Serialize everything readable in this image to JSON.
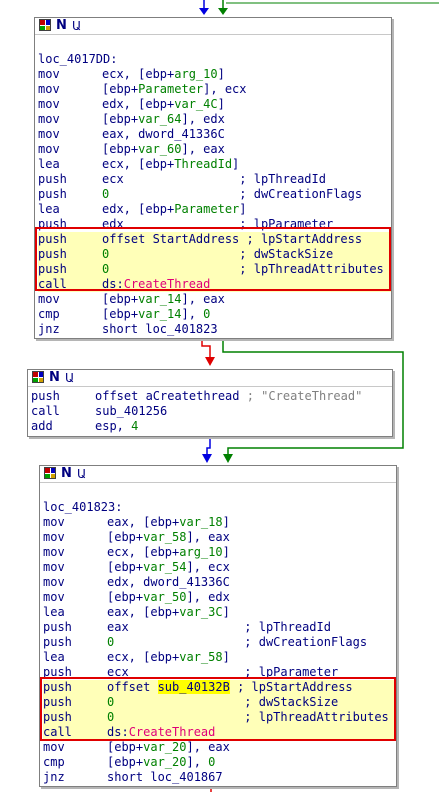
{
  "node1": {
    "label": "loc_4017DD:",
    "lines": [
      {
        "mn": "mov",
        "op": [
          {
            "t": "ecx, [ebp+",
            "c": "op"
          },
          {
            "t": "arg_10",
            "c": "var"
          },
          {
            "t": "]",
            "c": "op"
          }
        ]
      },
      {
        "mn": "mov",
        "op": [
          {
            "t": "[ebp+",
            "c": "op"
          },
          {
            "t": "Parameter",
            "c": "var"
          },
          {
            "t": "], ecx",
            "c": "op"
          }
        ]
      },
      {
        "mn": "mov",
        "op": [
          {
            "t": "edx, [ebp+",
            "c": "op"
          },
          {
            "t": "var_4C",
            "c": "var"
          },
          {
            "t": "]",
            "c": "op"
          }
        ]
      },
      {
        "mn": "mov",
        "op": [
          {
            "t": "[ebp+",
            "c": "op"
          },
          {
            "t": "var_64",
            "c": "var"
          },
          {
            "t": "], edx",
            "c": "op"
          }
        ]
      },
      {
        "mn": "mov",
        "op": [
          {
            "t": "eax, dword_41336C",
            "c": "op"
          }
        ]
      },
      {
        "mn": "mov",
        "op": [
          {
            "t": "[ebp+",
            "c": "op"
          },
          {
            "t": "var_60",
            "c": "var"
          },
          {
            "t": "], eax",
            "c": "op"
          }
        ]
      },
      {
        "mn": "lea",
        "op": [
          {
            "t": "ecx, [ebp+",
            "c": "op"
          },
          {
            "t": "ThreadId",
            "c": "var"
          },
          {
            "t": "]",
            "c": "op"
          }
        ]
      },
      {
        "mn": "push",
        "op": [
          {
            "t": "ecx                ",
            "c": "op"
          },
          {
            "t": "; lpThreadId",
            "c": "op"
          }
        ]
      },
      {
        "mn": "push",
        "op": [
          {
            "t": "0",
            "c": "num"
          },
          {
            "t": "                  ",
            "c": "op"
          },
          {
            "t": "; dwCreationFlags",
            "c": "op"
          }
        ]
      },
      {
        "mn": "lea",
        "op": [
          {
            "t": "edx, [ebp+",
            "c": "op"
          },
          {
            "t": "Parameter",
            "c": "var"
          },
          {
            "t": "]",
            "c": "op"
          }
        ]
      },
      {
        "mn": "push",
        "op": [
          {
            "t": "edx                ",
            "c": "op"
          },
          {
            "t": "; lpParameter",
            "c": "op"
          }
        ]
      },
      {
        "mn": "push",
        "op": [
          {
            "t": "offset StartAddress ",
            "c": "op"
          },
          {
            "t": "; lpStartAddress",
            "c": "op"
          }
        ],
        "y": true
      },
      {
        "mn": "push",
        "op": [
          {
            "t": "0",
            "c": "num"
          },
          {
            "t": "                  ",
            "c": "op"
          },
          {
            "t": "; dwStackSize",
            "c": "op"
          }
        ],
        "y": true
      },
      {
        "mn": "push",
        "op": [
          {
            "t": "0",
            "c": "num"
          },
          {
            "t": "                  ",
            "c": "op"
          },
          {
            "t": "; lpThreadAttributes",
            "c": "op"
          }
        ],
        "y": true
      },
      {
        "mn": "call",
        "op": [
          {
            "t": "ds:",
            "c": "op"
          },
          {
            "t": "CreateThread",
            "c": "imp"
          }
        ],
        "y": true
      },
      {
        "mn": "mov",
        "op": [
          {
            "t": "[ebp+",
            "c": "op"
          },
          {
            "t": "var_14",
            "c": "var"
          },
          {
            "t": "], eax",
            "c": "op"
          }
        ]
      },
      {
        "mn": "cmp",
        "op": [
          {
            "t": "[ebp+",
            "c": "op"
          },
          {
            "t": "var_14",
            "c": "var"
          },
          {
            "t": "], ",
            "c": "op"
          },
          {
            "t": "0",
            "c": "num"
          }
        ]
      },
      {
        "mn": "jnz",
        "op": [
          {
            "t": "short loc_401823",
            "c": "op"
          }
        ]
      }
    ]
  },
  "node2": {
    "lines": [
      {
        "mn": "push",
        "op": [
          {
            "t": "offset aCreatethread ",
            "c": "op"
          },
          {
            "t": "; \"CreateThread\"",
            "c": "com"
          }
        ]
      },
      {
        "mn": "call",
        "op": [
          {
            "t": "sub_401256",
            "c": "op"
          }
        ]
      },
      {
        "mn": "add",
        "op": [
          {
            "t": "esp, ",
            "c": "op"
          },
          {
            "t": "4",
            "c": "num"
          }
        ]
      }
    ]
  },
  "node3": {
    "label": "loc_401823:",
    "lines": [
      {
        "mn": "mov",
        "op": [
          {
            "t": "eax, [ebp+",
            "c": "op"
          },
          {
            "t": "var_18",
            "c": "var"
          },
          {
            "t": "]",
            "c": "op"
          }
        ]
      },
      {
        "mn": "mov",
        "op": [
          {
            "t": "[ebp+",
            "c": "op"
          },
          {
            "t": "var_58",
            "c": "var"
          },
          {
            "t": "], eax",
            "c": "op"
          }
        ]
      },
      {
        "mn": "mov",
        "op": [
          {
            "t": "ecx, [ebp+",
            "c": "op"
          },
          {
            "t": "arg_10",
            "c": "var"
          },
          {
            "t": "]",
            "c": "op"
          }
        ]
      },
      {
        "mn": "mov",
        "op": [
          {
            "t": "[ebp+",
            "c": "op"
          },
          {
            "t": "var_54",
            "c": "var"
          },
          {
            "t": "], ecx",
            "c": "op"
          }
        ]
      },
      {
        "mn": "mov",
        "op": [
          {
            "t": "edx, dword_41336C",
            "c": "op"
          }
        ]
      },
      {
        "mn": "mov",
        "op": [
          {
            "t": "[ebp+",
            "c": "op"
          },
          {
            "t": "var_50",
            "c": "var"
          },
          {
            "t": "], edx",
            "c": "op"
          }
        ]
      },
      {
        "mn": "lea",
        "op": [
          {
            "t": "eax, [ebp+",
            "c": "op"
          },
          {
            "t": "var_3C",
            "c": "var"
          },
          {
            "t": "]",
            "c": "op"
          }
        ]
      },
      {
        "mn": "push",
        "op": [
          {
            "t": "eax                ",
            "c": "op"
          },
          {
            "t": "; lpThreadId",
            "c": "op"
          }
        ]
      },
      {
        "mn": "push",
        "op": [
          {
            "t": "0",
            "c": "num"
          },
          {
            "t": "                  ",
            "c": "op"
          },
          {
            "t": "; dwCreationFlags",
            "c": "op"
          }
        ]
      },
      {
        "mn": "lea",
        "op": [
          {
            "t": "ecx, [ebp+",
            "c": "op"
          },
          {
            "t": "var_58",
            "c": "var"
          },
          {
            "t": "]",
            "c": "op"
          }
        ]
      },
      {
        "mn": "push",
        "op": [
          {
            "t": "ecx                ",
            "c": "op"
          },
          {
            "t": "; lpParameter",
            "c": "op"
          }
        ]
      },
      {
        "mn": "push",
        "op": [
          {
            "t": "offset ",
            "c": "op"
          },
          {
            "t": "sub_40132B",
            "c": "hl"
          },
          {
            "t": " ",
            "c": "op"
          },
          {
            "t": "; lpStartAddress",
            "c": "op"
          }
        ],
        "y": true
      },
      {
        "mn": "push",
        "op": [
          {
            "t": "0",
            "c": "num"
          },
          {
            "t": "                  ",
            "c": "op"
          },
          {
            "t": "; dwStackSize",
            "c": "op"
          }
        ],
        "y": true
      },
      {
        "mn": "push",
        "op": [
          {
            "t": "0",
            "c": "num"
          },
          {
            "t": "                  ",
            "c": "op"
          },
          {
            "t": "; lpThreadAttributes",
            "c": "op"
          }
        ],
        "y": true
      },
      {
        "mn": "call",
        "op": [
          {
            "t": "ds:",
            "c": "op"
          },
          {
            "t": "CreateThread",
            "c": "imp"
          }
        ],
        "y": true
      },
      {
        "mn": "mov",
        "op": [
          {
            "t": "[ebp+",
            "c": "op"
          },
          {
            "t": "var_20",
            "c": "var"
          },
          {
            "t": "], eax",
            "c": "op"
          }
        ]
      },
      {
        "mn": "cmp",
        "op": [
          {
            "t": "[ebp+",
            "c": "op"
          },
          {
            "t": "var_20",
            "c": "var"
          },
          {
            "t": "], ",
            "c": "op"
          },
          {
            "t": "0",
            "c": "num"
          }
        ]
      },
      {
        "mn": "jnz",
        "op": [
          {
            "t": "short loc_401867",
            "c": "op"
          }
        ]
      }
    ]
  },
  "colors": {
    "edge_blue": "#0000e0",
    "edge_green": "#008000",
    "edge_red": "#e00000",
    "highlight_box": "#e00000",
    "highlight_fill": "#ffffb8",
    "search_hit": "#ffff00"
  }
}
